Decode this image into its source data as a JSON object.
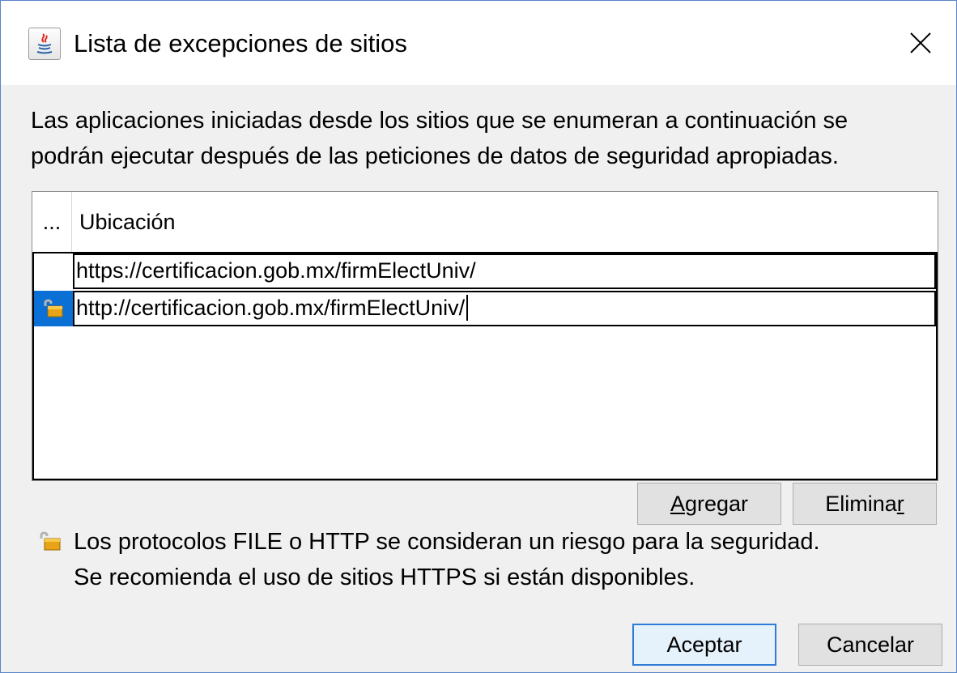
{
  "window": {
    "title": "Lista de excepciones de sitios",
    "icon": "java-icon",
    "close_icon": "close-icon"
  },
  "description": {
    "line1": "Las aplicaciones iniciadas desde los sitios que se enumeran a continuación se",
    "line2": "podrán ejecutar después de las peticiones de datos de seguridad apropiadas."
  },
  "table": {
    "columns": [
      "...",
      "Ubicación"
    ],
    "rows": [
      {
        "location": "https://certificacion.gob.mx/firmElectUniv/",
        "indicator_icon": "",
        "selected": false
      },
      {
        "location": "http://certificacion.gob.mx/firmElectUniv/",
        "indicator_icon": "unlocked-padlock-icon",
        "selected": true
      }
    ]
  },
  "buttons": {
    "add": {
      "pre": "",
      "mnemonic": "A",
      "post": "gregar"
    },
    "remove": {
      "pre": "Elimina",
      "mnemonic": "r",
      "post": ""
    },
    "ok": "Aceptar",
    "cancel": "Cancelar"
  },
  "warning": {
    "icon": "unlocked-padlock-icon",
    "line1": "Los protocolos FILE o HTTP se consideran un riesgo para la seguridad.",
    "line2": "Se recomienda el uso de sitios HTTPS si están disponibles."
  },
  "colors": {
    "selection": "#0a70d6",
    "default_button_border": "#2f7bd7",
    "window_border": "#5a85c8"
  }
}
